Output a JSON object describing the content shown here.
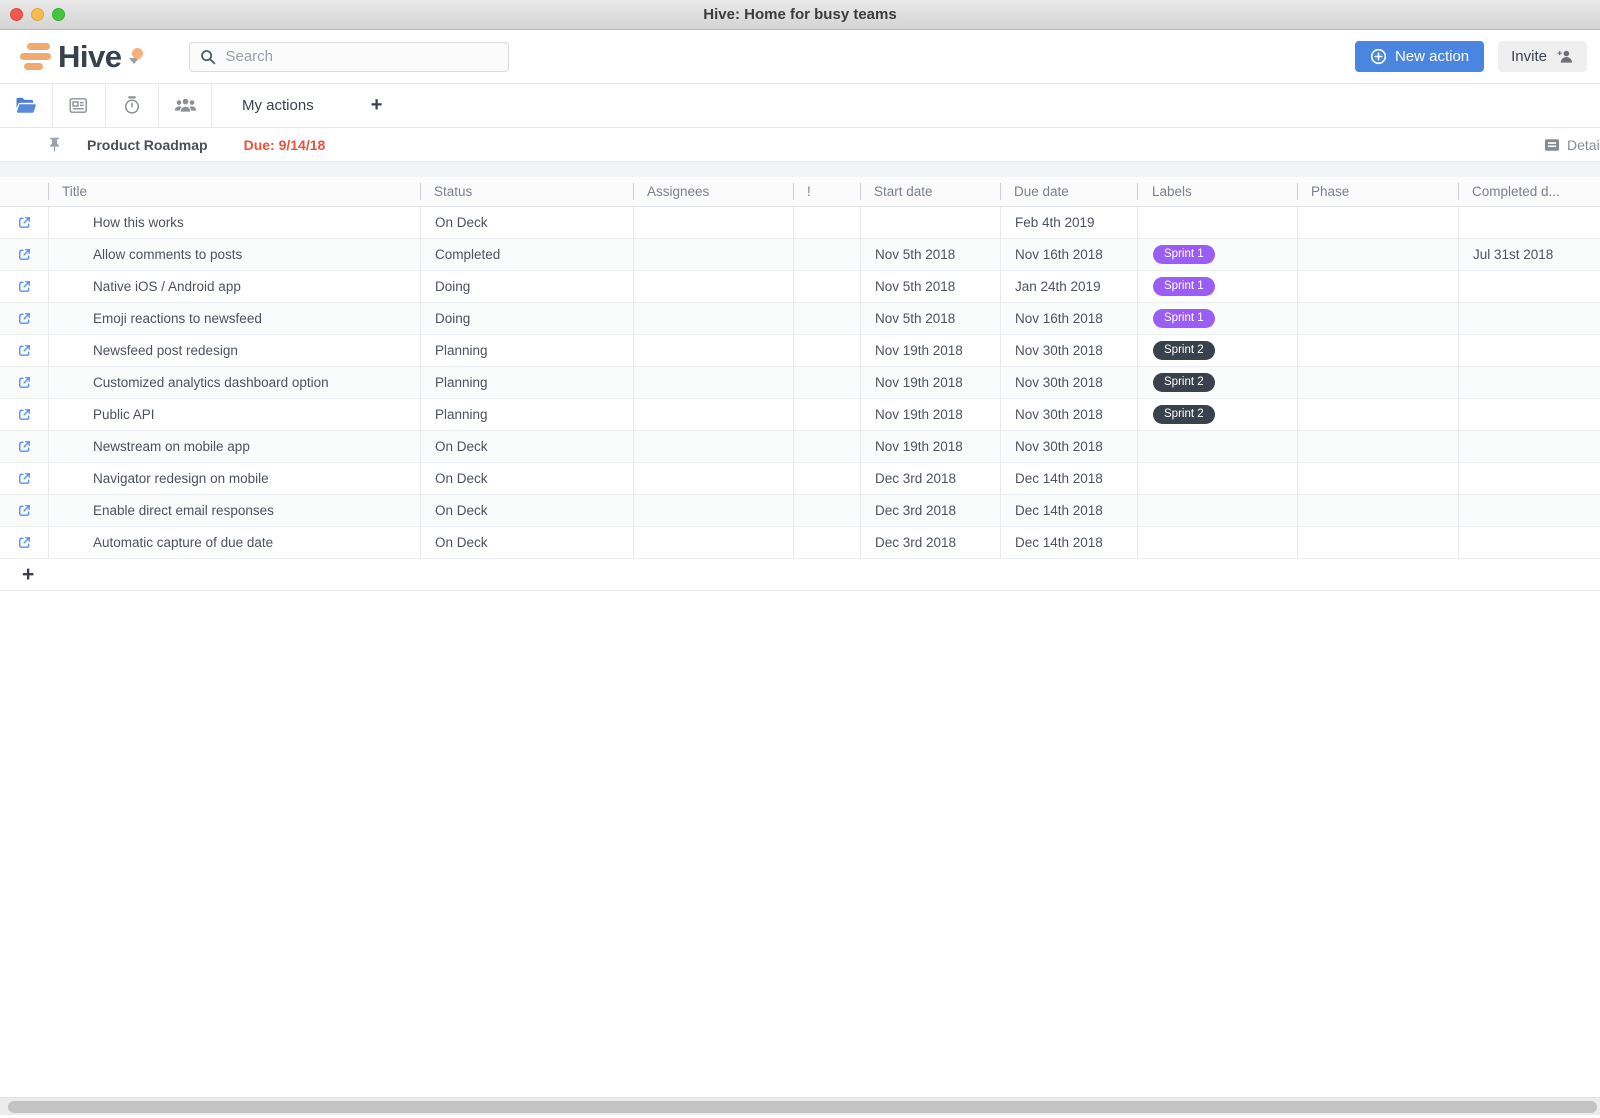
{
  "window": {
    "title": "Hive: Home for busy teams"
  },
  "header": {
    "logo_text": "Hive",
    "search_placeholder": "Search",
    "new_action_label": "New action",
    "invite_label": "Invite"
  },
  "tabbar": {
    "icons": [
      "folder-open-icon",
      "newsfeed-icon",
      "timer-icon",
      "team-icon"
    ],
    "my_actions_label": "My actions",
    "add_tab_label": "+"
  },
  "project_bar": {
    "title": "Product Roadmap",
    "due_label": "Due: 9/14/18",
    "detail_label": "Detail"
  },
  "table": {
    "columns": [
      "Title",
      "Status",
      "Assignees",
      "!",
      "Start date",
      "Due date",
      "Labels",
      "Phase",
      "Completed d..."
    ],
    "label_colors": {
      "Sprint 1": "#9b5ef5",
      "Sprint 2": "#39414d"
    },
    "rows": [
      {
        "title": "How this works",
        "status": "On Deck",
        "assignees": "",
        "priority": "",
        "start_date": "",
        "due_date": "Feb 4th 2019",
        "label": "",
        "phase": "",
        "completed_date": ""
      },
      {
        "title": "Allow comments to posts",
        "status": "Completed",
        "assignees": "",
        "priority": "",
        "start_date": "Nov 5th 2018",
        "due_date": "Nov 16th 2018",
        "label": "Sprint 1",
        "phase": "",
        "completed_date": "Jul 31st 2018"
      },
      {
        "title": "Native iOS / Android app",
        "status": "Doing",
        "assignees": "",
        "priority": "",
        "start_date": "Nov 5th 2018",
        "due_date": "Jan 24th 2019",
        "label": "Sprint 1",
        "phase": "",
        "completed_date": ""
      },
      {
        "title": "Emoji reactions to newsfeed",
        "status": "Doing",
        "assignees": "",
        "priority": "",
        "start_date": "Nov 5th 2018",
        "due_date": "Nov 16th 2018",
        "label": "Sprint 1",
        "phase": "",
        "completed_date": ""
      },
      {
        "title": "Newsfeed post redesign",
        "status": "Planning",
        "assignees": "",
        "priority": "",
        "start_date": "Nov 19th 2018",
        "due_date": "Nov 30th 2018",
        "label": "Sprint 2",
        "phase": "",
        "completed_date": ""
      },
      {
        "title": "Customized analytics dashboard option",
        "status": "Planning",
        "assignees": "",
        "priority": "",
        "start_date": "Nov 19th 2018",
        "due_date": "Nov 30th 2018",
        "label": "Sprint 2",
        "phase": "",
        "completed_date": ""
      },
      {
        "title": "Public API",
        "status": "Planning",
        "assignees": "",
        "priority": "",
        "start_date": "Nov 19th 2018",
        "due_date": "Nov 30th 2018",
        "label": "Sprint 2",
        "phase": "",
        "completed_date": ""
      },
      {
        "title": "Newstream on mobile app",
        "status": "On Deck",
        "assignees": "",
        "priority": "",
        "start_date": "Nov 19th 2018",
        "due_date": "Nov 30th 2018",
        "label": "",
        "phase": "",
        "completed_date": ""
      },
      {
        "title": "Navigator redesign on mobile",
        "status": "On Deck",
        "assignees": "",
        "priority": "",
        "start_date": "Dec 3rd 2018",
        "due_date": "Dec 14th 2018",
        "label": "",
        "phase": "",
        "completed_date": ""
      },
      {
        "title": "Enable direct email responses",
        "status": "On Deck",
        "assignees": "",
        "priority": "",
        "start_date": "Dec 3rd 2018",
        "due_date": "Dec 14th 2018",
        "label": "",
        "phase": "",
        "completed_date": ""
      },
      {
        "title": "Automatic capture of due date",
        "status": "On Deck",
        "assignees": "",
        "priority": "",
        "start_date": "Dec 3rd 2018",
        "due_date": "Dec 14th 2018",
        "label": "",
        "phase": "",
        "completed_date": ""
      }
    ],
    "add_row_label": "+"
  },
  "colors": {
    "accent_blue": "#4a85e0",
    "logo_orange": "#f0a96e",
    "due_red": "#e8513e",
    "sprint1_purple": "#9b5ef5",
    "sprint2_dark": "#39414d",
    "link_icon_blue": "#5b8def"
  }
}
